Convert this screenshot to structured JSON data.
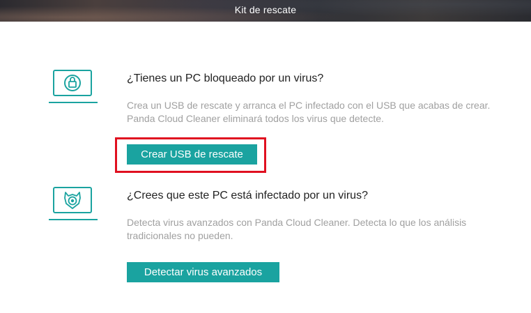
{
  "window": {
    "title": "Kit de rescate"
  },
  "sections": [
    {
      "icon": "locked-laptop-icon",
      "heading": "¿Tienes un PC bloqueado por un virus?",
      "description": "Crea un USB de rescate y arranca el PC infectado con el USB que acabas de crear. Panda Cloud Cleaner eliminará todos los virus que detecte.",
      "button_label": "Crear USB de rescate"
    },
    {
      "icon": "panda-laptop-icon",
      "heading": "¿Crees que este PC está infectado por un virus?",
      "description": "Detecta virus avanzados con Panda Cloud Cleaner. Detecta lo que los análisis tradicionales no pueden.",
      "button_label": "Detectar virus avanzados"
    }
  ],
  "colors": {
    "accent": "#1aa3a0",
    "highlight": "#e01020",
    "heading": "#222222",
    "description": "#a0a0a0"
  }
}
